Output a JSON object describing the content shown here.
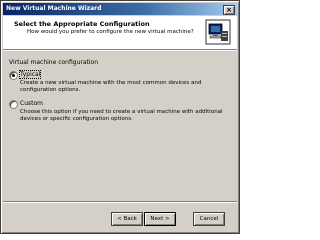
{
  "window": {
    "title": "New Virtual Machine Wizard",
    "close_label": "×"
  },
  "header": {
    "title": "Select the Appropriate Configuration",
    "subtitle": "How would you prefer to configure the new virtual machine?",
    "icon": "wizard-monitor-icon"
  },
  "config": {
    "section_label": "Virtual machine configuration",
    "options": [
      {
        "label": "Typical",
        "selected": true,
        "description": "Create a new virtual machine with the most common devices and configuration options."
      },
      {
        "label": "Custom",
        "selected": false,
        "description": "Choose this option if you need to create a virtual machine with additional devices or specific configuration options."
      }
    ]
  },
  "buttons": {
    "back": "< Back",
    "next": "Next >",
    "cancel": "Cancel"
  },
  "colors": {
    "titlebar_start": "#0a246a",
    "titlebar_end": "#a6caf0",
    "dialog_face": "#d4d0c8"
  }
}
